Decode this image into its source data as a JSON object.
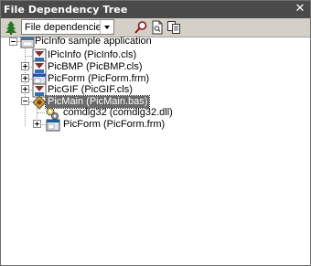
{
  "window": {
    "title": "File Dependency Tree",
    "close_glyph": "✕"
  },
  "toolbar": {
    "tree_icon": "tree-icon",
    "combo_value": "File dependencies",
    "find_icon": "find-icon",
    "view_icon": "document-view-icon",
    "copy_icon": "copy-icon"
  },
  "tree": {
    "root": {
      "label": "PicInfo sample application",
      "icon": "application-icon",
      "expanded": true
    },
    "children": [
      {
        "label": "IPicInfo (PicInfo.cls)",
        "icon": "class-module-icon",
        "expandable": false
      },
      {
        "label": "PicBMP (PicBMP.cls)",
        "icon": "class-module-icon",
        "expandable": true
      },
      {
        "label": "PicForm (PicForm.frm)",
        "icon": "form-icon",
        "expandable": true
      },
      {
        "label": "PicGIF (PicGIF.cls)",
        "icon": "class-module-icon",
        "expandable": true
      },
      {
        "label": "PicMain (PicMain.bas)",
        "icon": "module-icon",
        "expanded": true,
        "selected": true,
        "children": [
          {
            "label": "comdlg32 (comdlg32.dll)",
            "icon": "dll-icon",
            "expandable": false
          },
          {
            "label": "PicForm (PicForm.frm)",
            "icon": "form-icon",
            "expandable": true
          }
        ]
      }
    ]
  },
  "colors": {
    "titlebar": "#4a4a4a",
    "toolbar": "#d4d0c8",
    "selection": "#6a6a6a"
  }
}
